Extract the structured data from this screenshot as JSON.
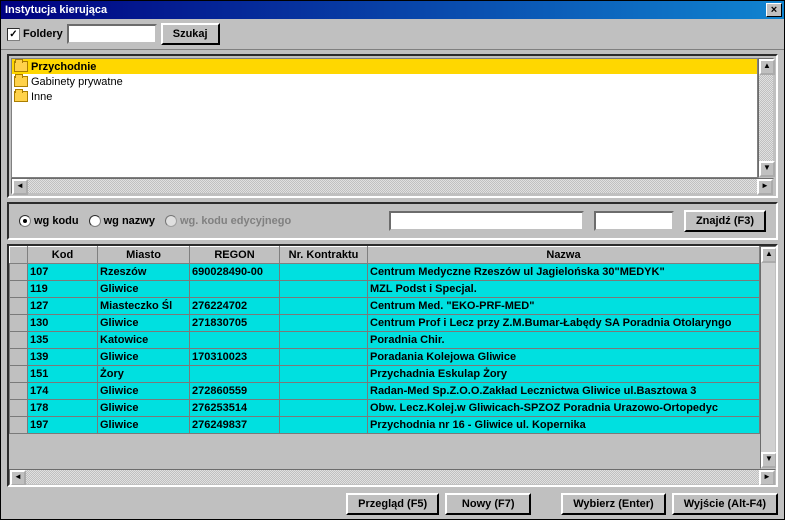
{
  "title": "Instytucja kierująca",
  "toolbar": {
    "foldery_label": "Foldery",
    "foldery_checked": true,
    "search_value": "",
    "szukaj_label": "Szukaj"
  },
  "tree": {
    "items": [
      {
        "label": "Przychodnie",
        "selected": true
      },
      {
        "label": "Gabinety prywatne",
        "selected": false
      },
      {
        "label": "Inne",
        "selected": false
      }
    ]
  },
  "radio": {
    "wg_kodu": "wg kodu",
    "wg_nazwy": "wg nazwy",
    "wg_kodu_edyc": "wg. kodu edycyjnego",
    "selected": "wg_kodu",
    "input1": "",
    "input2": "",
    "znajdz_label": "Znajdź (F3)"
  },
  "table": {
    "headers": {
      "blank": "",
      "kod": "Kod",
      "miasto": "Miasto",
      "regon": "REGON",
      "nr_kontraktu": "Nr. Kontraktu",
      "nazwa": "Nazwa"
    },
    "rows": [
      {
        "kod": "107",
        "miasto": "Rzeszów",
        "regon": "690028490-00",
        "nr": "",
        "nazwa": "Centrum Medyczne Rzeszów ul Jagielońska 30\"MEDYK\""
      },
      {
        "kod": "119",
        "miasto": "Gliwice",
        "regon": "",
        "nr": "",
        "nazwa": "MZL Podst i Specjal."
      },
      {
        "kod": "127",
        "miasto": "Miasteczko Śl",
        "regon": "276224702",
        "nr": "",
        "nazwa": "Centrum Med. \"EKO-PRF-MED\""
      },
      {
        "kod": "130",
        "miasto": "Gliwice",
        "regon": "271830705",
        "nr": "",
        "nazwa": "Centrum Prof i Lecz przy Z.M.Bumar-Łabędy SA Poradnia Otolaryngo"
      },
      {
        "kod": "135",
        "miasto": "Katowice",
        "regon": "",
        "nr": "",
        "nazwa": "Poradnia Chir."
      },
      {
        "kod": "139",
        "miasto": "Gliwice",
        "regon": "170310023",
        "nr": "",
        "nazwa": "Poradania Kolejowa Gliwice"
      },
      {
        "kod": "151",
        "miasto": "Żory",
        "regon": "",
        "nr": "",
        "nazwa": "Przychadnia Eskulap Żory"
      },
      {
        "kod": "174",
        "miasto": "Gliwice",
        "regon": "272860559",
        "nr": "",
        "nazwa": "Radan-Med Sp.Z.O.O.Zakład Lecznictwa Gliwice ul.Basztowa 3"
      },
      {
        "kod": "178",
        "miasto": "Gliwice",
        "regon": "276253514",
        "nr": "",
        "nazwa": "Obw. Lecz.Kolej.w Gliwicach-SPZOZ  Poradnia Urazowo-Ortopedyc"
      },
      {
        "kod": "197",
        "miasto": "Gliwice",
        "regon": "276249837",
        "nr": "",
        "nazwa": " Przychodnia nr 16 - Gliwice ul. Kopernika"
      }
    ]
  },
  "footer": {
    "przeglad": "Przegląd (F5)",
    "nowy": "Nowy (F7)",
    "wybierz": "Wybierz (Enter)",
    "wyjscie": "Wyjście (Alt-F4)"
  }
}
